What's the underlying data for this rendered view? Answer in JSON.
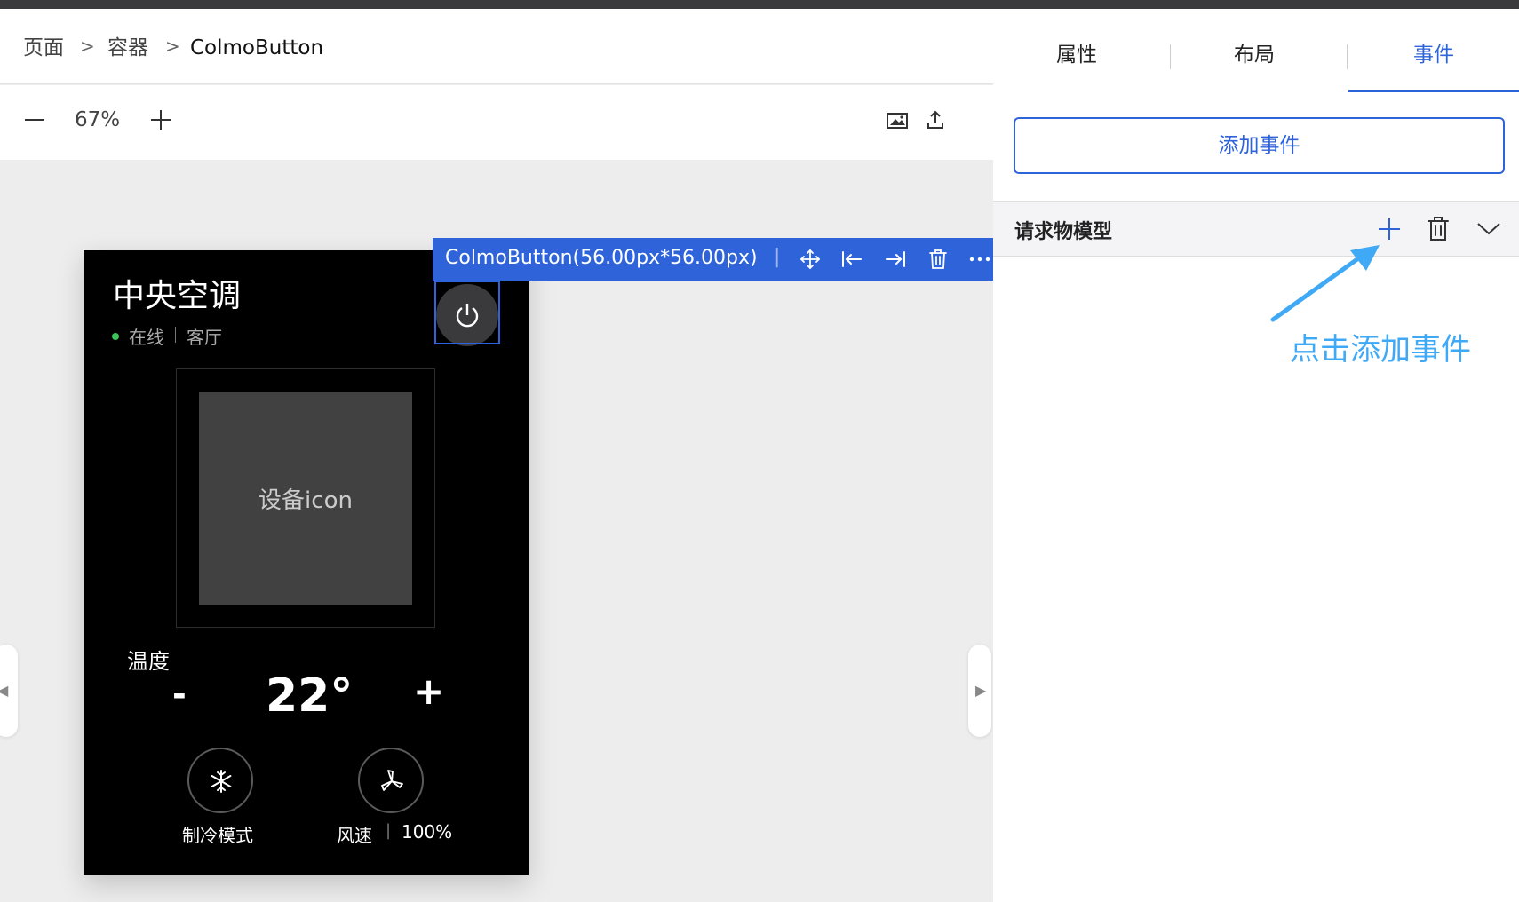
{
  "breadcrumb": [
    "页面",
    "容器",
    "ColmoButton"
  ],
  "breadcrumb_separator": ">",
  "zoom": "67%",
  "device": {
    "title": "中央空调",
    "status": "在线",
    "room": "客厅",
    "icon_placeholder": "设备icon",
    "temp_label": "温度",
    "temp_minus": "-",
    "temp_value": "22°",
    "temp_plus": "+",
    "mode_label": "制冷模式",
    "fan_label": "风速",
    "fan_sep": "|",
    "fan_value": "100%",
    "status_color": "#3cc35a"
  },
  "selection": {
    "label": "ColmoButton(56.00px*56.00px)",
    "sep": "|"
  },
  "panel": {
    "tabs": [
      "属性",
      "布局",
      "事件"
    ],
    "active_tab": "事件",
    "add_event_label": "添加事件",
    "section_title": "请求物模型",
    "annotation": "点击添加事件"
  },
  "colors": {
    "accent": "#2e63d9",
    "annotation": "#3fa9f5"
  },
  "icons": {
    "zoom_out": "minus-icon",
    "zoom_in": "plus-icon",
    "image": "image-icon",
    "export": "upload-icon",
    "move": "move-icon",
    "align_left": "align-left-icon",
    "align_right": "align-right-icon",
    "delete": "trash-icon",
    "more": "more-icon",
    "power": "power-icon",
    "snowflake": "snowflake-icon",
    "fan": "fan-icon",
    "collapse": "chevron-down-icon"
  }
}
